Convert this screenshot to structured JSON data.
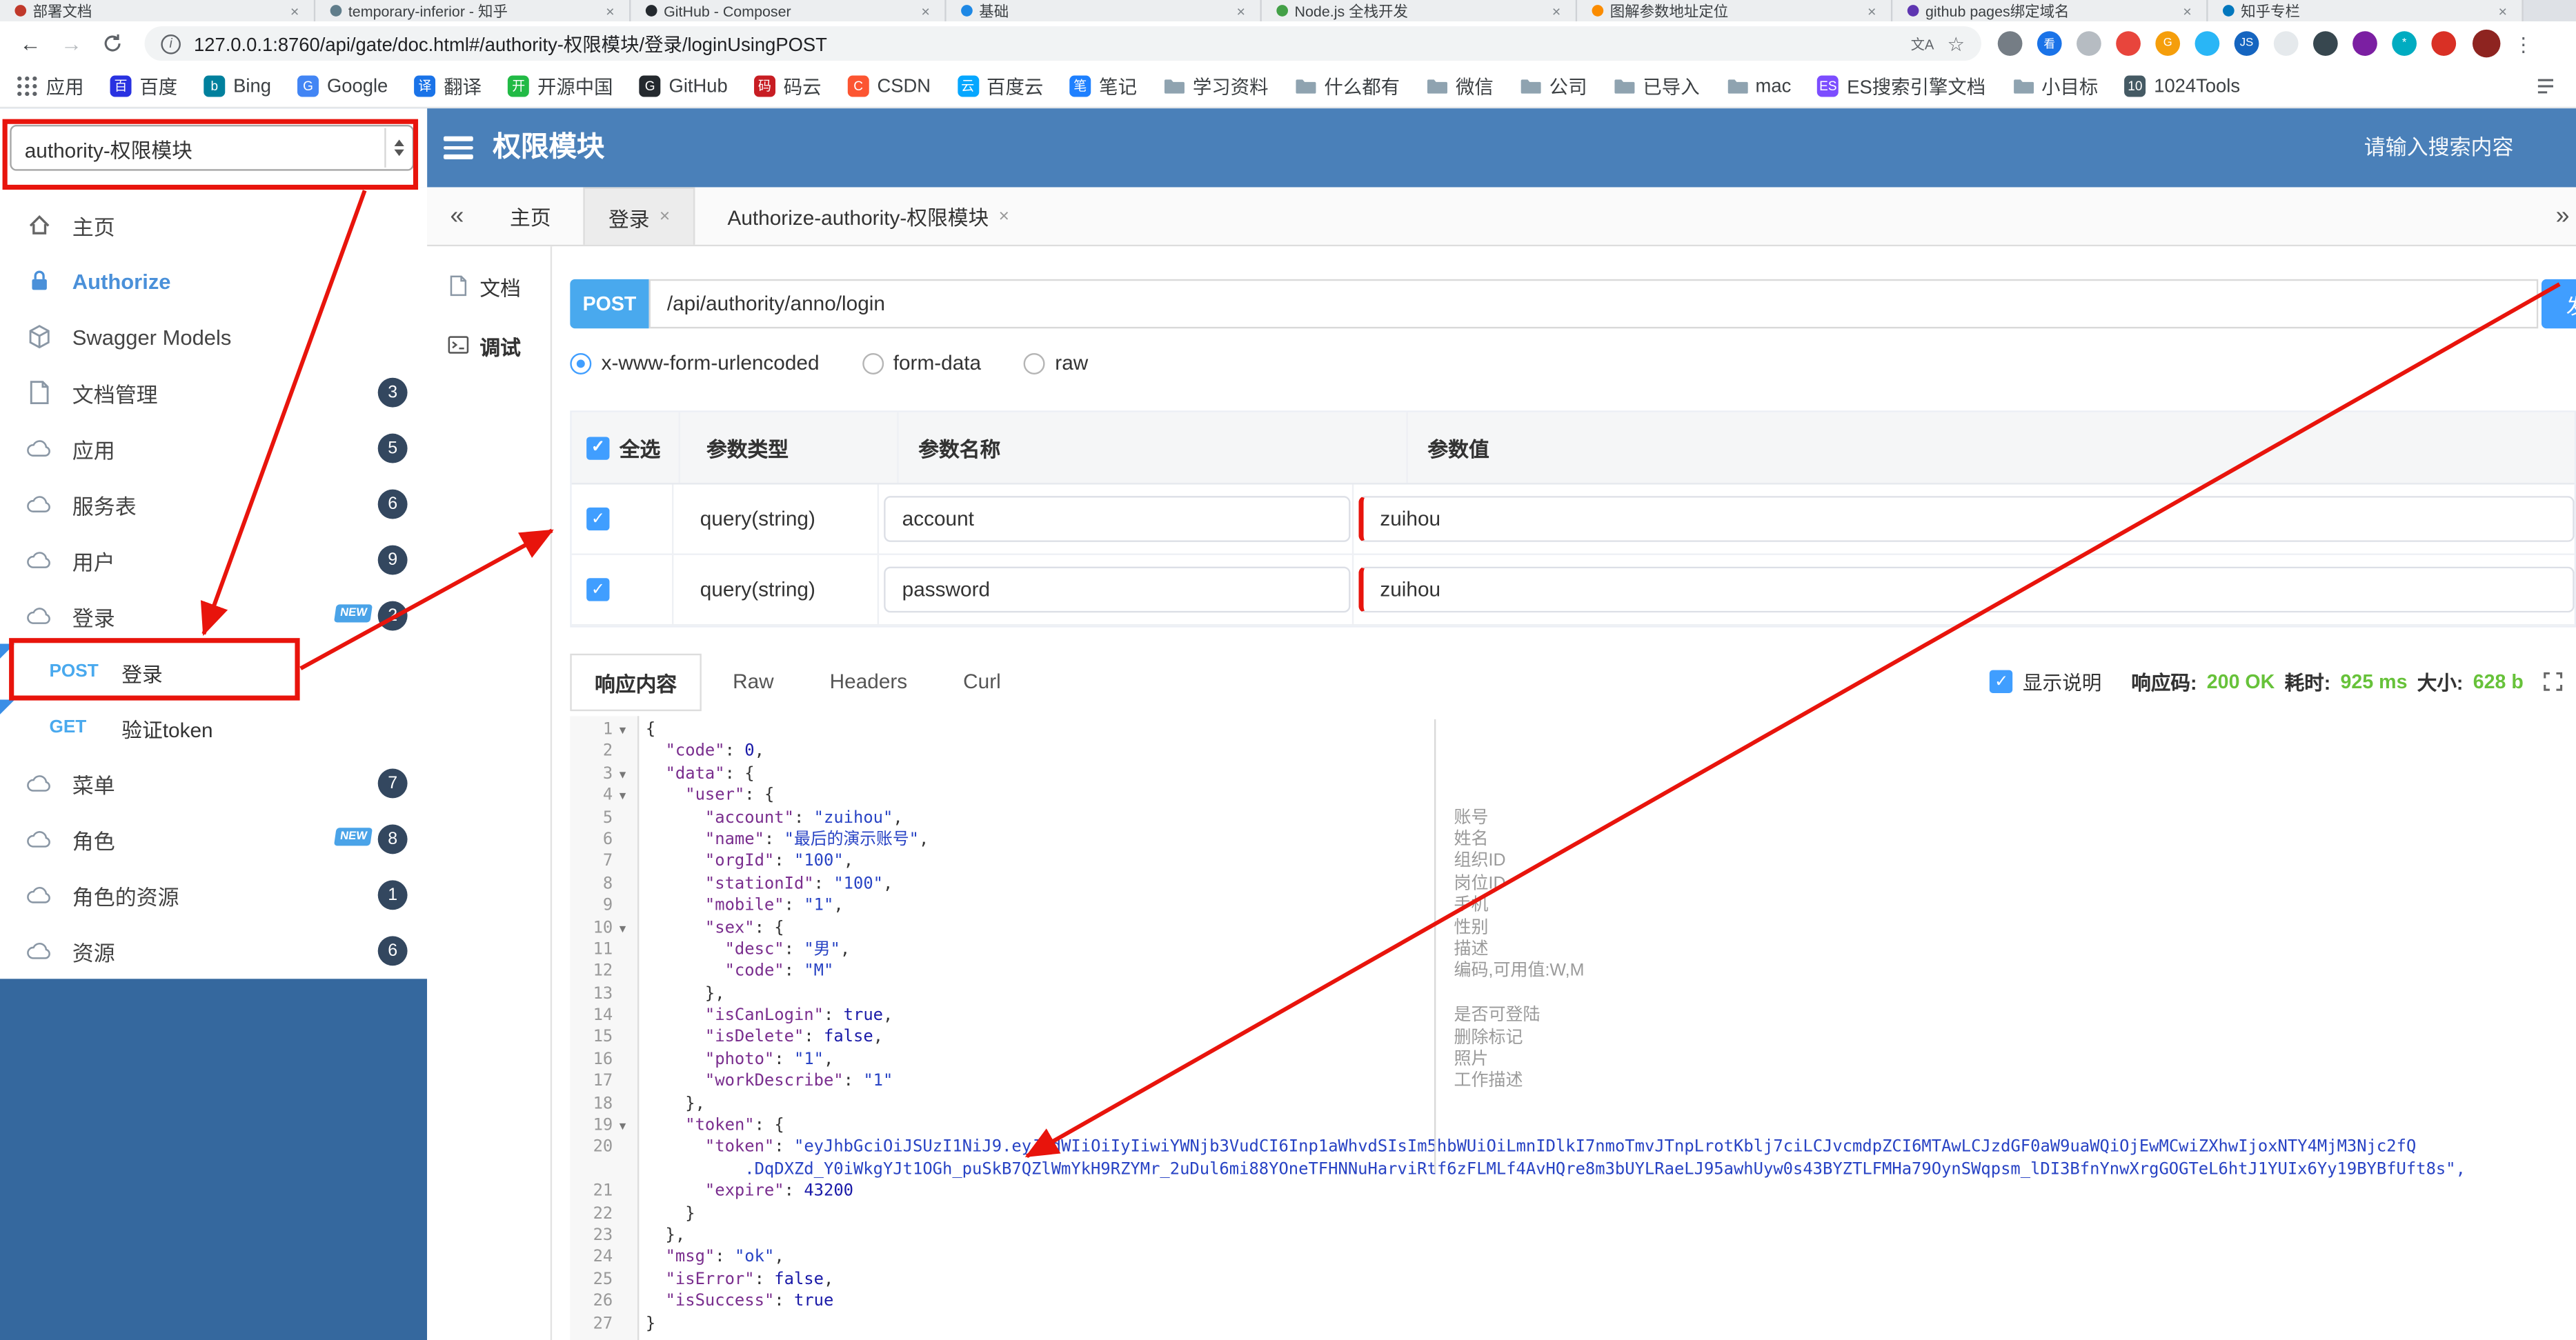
{
  "colors": {
    "header_blue": "#4a80b9",
    "sidebar_footer_blue": "#35689e",
    "accent_blue": "#409eff",
    "method_blue": "#49a9ee",
    "success_green": "#67c23a",
    "annotation_red": "#e8140c",
    "badge_navy": "#33475f"
  },
  "browser": {
    "url": "127.0.0.1:8760/api/gate/doc.html#/authority-权限模块/登录/loginUsingPOST",
    "tabs": [
      {
        "title": "部署文档",
        "color": "#c0392b"
      },
      {
        "title": "temporary-inferior - 知乎",
        "color": "#607d8b"
      },
      {
        "title": "GitHub - Composer",
        "color": "#24292e"
      },
      {
        "title": "基础",
        "color": "#1e88e5"
      },
      {
        "title": "Node.js 全栈开发",
        "color": "#43a047"
      },
      {
        "title": "图解参数地址定位",
        "color": "#fb8c00"
      },
      {
        "title": "github pages绑定域名",
        "color": "#5e35b1"
      },
      {
        "title": "知乎专栏",
        "color": "#0277bd"
      }
    ],
    "extensions": [
      {
        "color": "#757d85",
        "char": ""
      },
      {
        "color": "#1a73e8",
        "char": "看"
      },
      {
        "color": "#b6bcc2",
        "char": ""
      },
      {
        "color": "#e8453c",
        "char": ""
      },
      {
        "color": "#f59e0b",
        "char": "G"
      },
      {
        "color": "#29b6f6",
        "char": ""
      },
      {
        "color": "#1565c0",
        "char": "JS"
      },
      {
        "color": "#e5e9ec",
        "char": ""
      },
      {
        "color": "#37474f",
        "char": ""
      },
      {
        "color": "#7b1fa2",
        "char": ""
      },
      {
        "color": "#00acc1",
        "char": "*"
      },
      {
        "color": "#d93025",
        "char": ""
      }
    ],
    "bookmarks": [
      {
        "label": "应用",
        "icon": "apps"
      },
      {
        "label": "百度",
        "icon": "letter",
        "color": "#2932e1",
        "char": "百"
      },
      {
        "label": "Bing",
        "icon": "letter",
        "color": "#00809d",
        "char": "b"
      },
      {
        "label": "Google",
        "icon": "letter",
        "color": "#4285f4",
        "char": "G"
      },
      {
        "label": "翻译",
        "icon": "letter",
        "color": "#1a73e8",
        "char": "译"
      },
      {
        "label": "开源中国",
        "icon": "letter",
        "color": "#21ba45",
        "char": "开"
      },
      {
        "label": "GitHub",
        "icon": "letter",
        "color": "#24292e",
        "char": "G"
      },
      {
        "label": "码云",
        "icon": "letter",
        "color": "#c71d23",
        "char": "码"
      },
      {
        "label": "CSDN",
        "icon": "letter",
        "color": "#fc5531",
        "char": "C"
      },
      {
        "label": "百度云",
        "icon": "letter",
        "color": "#06a7ff",
        "char": "云"
      },
      {
        "label": "笔记",
        "icon": "letter",
        "color": "#1e80ff",
        "char": "笔"
      },
      {
        "label": "学习资料",
        "icon": "folder"
      },
      {
        "label": "什么都有",
        "icon": "folder"
      },
      {
        "label": "微信",
        "icon": "folder"
      },
      {
        "label": "公司",
        "icon": "folder"
      },
      {
        "label": "已导入",
        "icon": "folder"
      },
      {
        "label": "mac",
        "icon": "folder"
      },
      {
        "label": "ES搜索引擎文档",
        "icon": "letter",
        "color": "#7c4dff",
        "char": "ES"
      },
      {
        "label": "小目标",
        "icon": "folder"
      },
      {
        "label": "1024Tools",
        "icon": "letter",
        "color": "#455a64",
        "char": "10"
      }
    ]
  },
  "header": {
    "group_select": "authority-权限模块",
    "title": "权限模块",
    "search_placeholder": "请输入搜索内容"
  },
  "sidebar": {
    "items": [
      {
        "label": "主页",
        "icon": "home"
      },
      {
        "label": "Authorize",
        "icon": "lock",
        "active": true
      },
      {
        "label": "Swagger Models",
        "icon": "cube"
      },
      {
        "label": "文档管理",
        "icon": "doc",
        "badge": "3"
      },
      {
        "label": "应用",
        "icon": "cloud",
        "badge": "5"
      },
      {
        "label": "服务表",
        "icon": "cloud",
        "badge": "6"
      },
      {
        "label": "用户",
        "icon": "cloud",
        "badge": "9"
      },
      {
        "label": "登录",
        "icon": "cloud",
        "badge": "2",
        "new": true
      },
      {
        "label": "登录",
        "method": "POST",
        "boxed": true
      },
      {
        "label": "验证token",
        "method": "GET"
      },
      {
        "label": "菜单",
        "icon": "cloud",
        "badge": "7"
      },
      {
        "label": "角色",
        "icon": "cloud",
        "badge": "8",
        "new": true
      },
      {
        "label": "角色的资源",
        "icon": "cloud",
        "badge": "1"
      },
      {
        "label": "资源",
        "icon": "cloud",
        "badge": "6"
      }
    ]
  },
  "tabs": {
    "collapse": "«",
    "expand": "»",
    "items": [
      {
        "label": "主页"
      },
      {
        "label": "登录",
        "closable": true,
        "active": true
      },
      {
        "label": "Authorize-authority-权限模块",
        "closable": true
      }
    ]
  },
  "doc_nav": [
    {
      "label": "文档",
      "icon": "doc"
    },
    {
      "label": "调试",
      "icon": "term",
      "active": true
    }
  ],
  "debug": {
    "method": "POST",
    "url": "/api/authority/anno/login",
    "send_label": "发送",
    "content_types": [
      {
        "label": "x-www-form-urlencoded",
        "selected": true
      },
      {
        "label": "form-data"
      },
      {
        "label": "raw"
      }
    ],
    "params_table": {
      "headers": [
        "全选",
        "参数类型",
        "参数名称",
        "参数值"
      ],
      "rows": [
        {
          "checked": true,
          "type": "query(string)",
          "name": "account",
          "value": "zuihou"
        },
        {
          "checked": true,
          "type": "query(string)",
          "name": "password",
          "value": "zuihou"
        }
      ]
    }
  },
  "response": {
    "tabs": [
      {
        "label": "响应内容",
        "active": true
      },
      {
        "label": "Raw"
      },
      {
        "label": "Headers"
      },
      {
        "label": "Curl"
      }
    ],
    "show_desc_label": "显示说明",
    "meta": {
      "code_label": "响应码:",
      "code": "200 OK",
      "time_label": "耗时:",
      "time": "925 ms",
      "size_label": "大小:",
      "size": "628 b"
    }
  },
  "editor": {
    "lines": [
      {
        "n": 1,
        "fold": true,
        "text": "{"
      },
      {
        "n": 2,
        "text": "  \"code\": 0,"
      },
      {
        "n": 3,
        "fold": true,
        "text": "  \"data\": {"
      },
      {
        "n": 4,
        "fold": true,
        "text": "    \"user\": {"
      },
      {
        "n": 5,
        "text": "      \"account\": \"zuihou\","
      },
      {
        "n": 6,
        "text": "      \"name\": \"最后的演示账号\","
      },
      {
        "n": 7,
        "text": "      \"orgId\": \"100\","
      },
      {
        "n": 8,
        "text": "      \"stationId\": \"100\","
      },
      {
        "n": 9,
        "text": "      \"mobile\": \"1\","
      },
      {
        "n": 10,
        "fold": true,
        "text": "      \"sex\": {"
      },
      {
        "n": 11,
        "text": "        \"desc\": \"男\","
      },
      {
        "n": 12,
        "text": "        \"code\": \"M\""
      },
      {
        "n": 13,
        "text": "      },"
      },
      {
        "n": 14,
        "text": "      \"isCanLogin\": true,"
      },
      {
        "n": 15,
        "text": "      \"isDelete\": false,"
      },
      {
        "n": 16,
        "text": "      \"photo\": \"1\","
      },
      {
        "n": 17,
        "text": "      \"workDescribe\": \"1\""
      },
      {
        "n": 18,
        "text": "    },"
      },
      {
        "n": 19,
        "fold": true,
        "text": "    \"token\": {"
      },
      {
        "n": 20,
        "text": "      \"token\": \"eyJhbGciOiJSUzI1NiJ9.eyJzdWIiOiIyIiwiYWNjb3VudCI6Inp1aWhvdSIsIm5hbWUiOiLmnIDlkI7nmoTmvJTnpLrotKblj7ciLCJvcmdpZCI6MTAwLCJzdGF0aW9uaWQiOjEwMCwiZXhwIjoxNTY4MjM3Njc2fQ"
      },
      {
        "text": "          .DqDXZd_Y0iWkgYJt1OGh_puSkB7QZlWmYkH9RZYMr_2uDul6mi88YOneTFHNNuHarviRtf6zFLMLf4AvHQre8m3bUYLRaeLJ95awhUyw0s43BYZTLFMHa79OynSWqpsm_lDI3BfnYnwXrgGOGTeL6htJ1YUIx6Yy19BYBfUft8s\","
      },
      {
        "n": 21,
        "text": "      \"expire\": 43200"
      },
      {
        "n": 22,
        "text": "    }"
      },
      {
        "n": 23,
        "text": "  },"
      },
      {
        "n": 24,
        "text": "  \"msg\": \"ok\","
      },
      {
        "n": 25,
        "text": "  \"isError\": false,"
      },
      {
        "n": 26,
        "text": "  \"isSuccess\": true"
      },
      {
        "n": 27,
        "text": "}"
      }
    ],
    "descriptions": [
      {
        "line": 5,
        "text": "账号"
      },
      {
        "line": 6,
        "text": "姓名"
      },
      {
        "line": 7,
        "text": "组织ID"
      },
      {
        "line": 8,
        "text": "岗位ID"
      },
      {
        "line": 9,
        "text": "手机"
      },
      {
        "line": 10,
        "text": "性别"
      },
      {
        "line": 11,
        "text": "描述"
      },
      {
        "line": 12,
        "text": "编码,可用值:W,M"
      },
      {
        "line": 14,
        "text": "是否可登陆"
      },
      {
        "line": 15,
        "text": "删除标记"
      },
      {
        "line": 16,
        "text": "照片"
      },
      {
        "line": 17,
        "text": "工作描述"
      }
    ]
  }
}
